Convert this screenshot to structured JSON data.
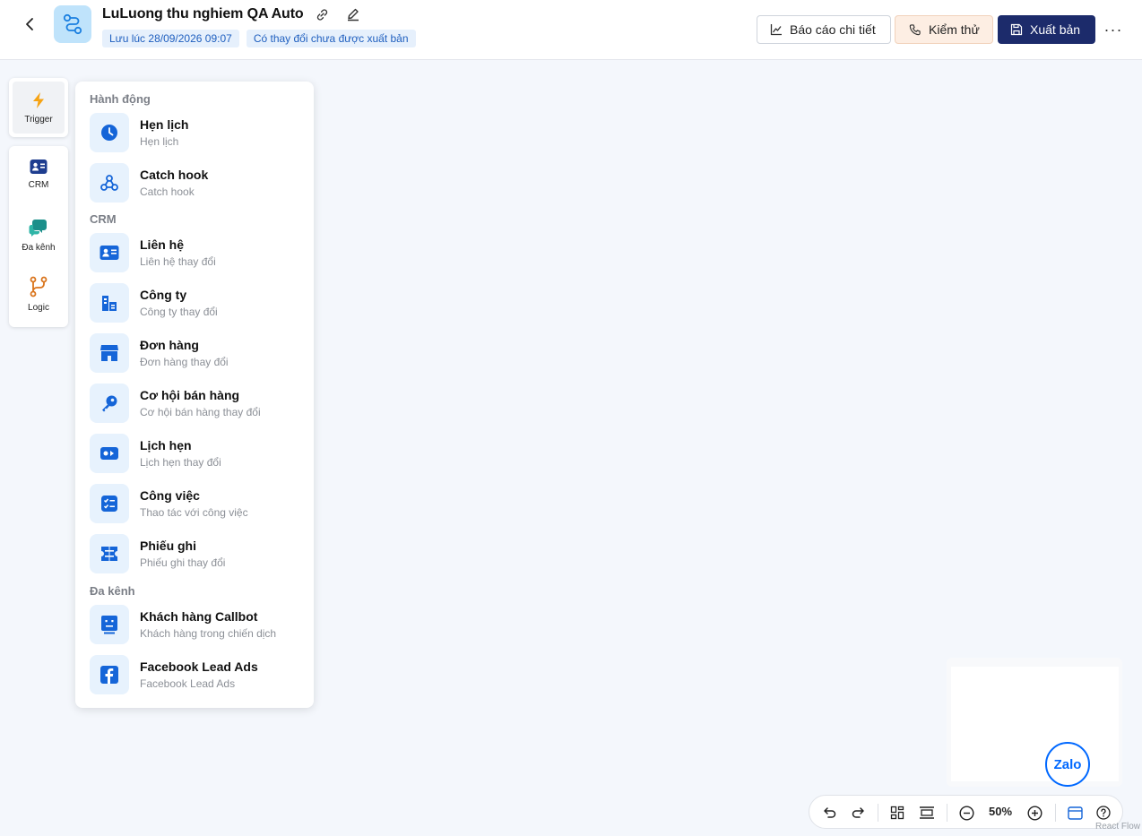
{
  "header": {
    "title": "LuLuong thu nghiem QA Auto",
    "saved_badge": "Lưu lúc 28/09/2026 09:07",
    "unpublished_badge": "Có thay đổi chưa được xuất bản",
    "report_label": "Báo cáo chi tiết",
    "test_label": "Kiểm thử",
    "publish_label": "Xuất bản",
    "more_label": "···"
  },
  "rail": {
    "trigger_label": "Trigger",
    "crm_label": "CRM",
    "omni_label": "Đa kênh",
    "logic_label": "Logic"
  },
  "popover": {
    "sections": [
      {
        "title": "Hành động"
      },
      {
        "title": "CRM"
      },
      {
        "title": "Đa kênh"
      }
    ],
    "items": [
      {
        "title": "Hẹn lịch",
        "sub": "Hẹn lịch",
        "icon": "clock-icon"
      },
      {
        "title": "Catch hook",
        "sub": "Catch hook",
        "icon": "webhook-icon"
      },
      {
        "title": "Liên hệ",
        "sub": "Liên hệ thay đổi",
        "icon": "contact-card-icon"
      },
      {
        "title": "Công ty",
        "sub": "Công ty thay đổi",
        "icon": "company-icon"
      },
      {
        "title": "Đơn hàng",
        "sub": "Đơn hàng thay đổi",
        "icon": "store-icon"
      },
      {
        "title": "Cơ hội bán hàng",
        "sub": "Cơ hội bán hàng thay đổi",
        "icon": "key-icon"
      },
      {
        "title": "Lịch hẹn",
        "sub": "Lịch hẹn thay đổi",
        "icon": "video-icon"
      },
      {
        "title": "Công việc",
        "sub": "Thao tác với công việc",
        "icon": "task-list-icon"
      },
      {
        "title": "Phiếu ghi",
        "sub": "Phiếu ghi thay đổi",
        "icon": "ticket-icon"
      },
      {
        "title": "Khách hàng Callbot",
        "sub": "Khách hàng trong chiến dịch",
        "icon": "bot-icon"
      },
      {
        "title": "Facebook Lead Ads",
        "sub": "Facebook Lead Ads",
        "icon": "facebook-icon"
      }
    ]
  },
  "toolbar": {
    "zoom": "50%"
  },
  "zalo_label": "Zalo",
  "watermark": "React Flow",
  "colors": {
    "accent": "#1565d8",
    "publish_bg": "#1c2b6b",
    "icon_bg": "#e7f2fd",
    "test_bg": "#fdeee3",
    "canvas_bg": "#f4f7fc"
  }
}
